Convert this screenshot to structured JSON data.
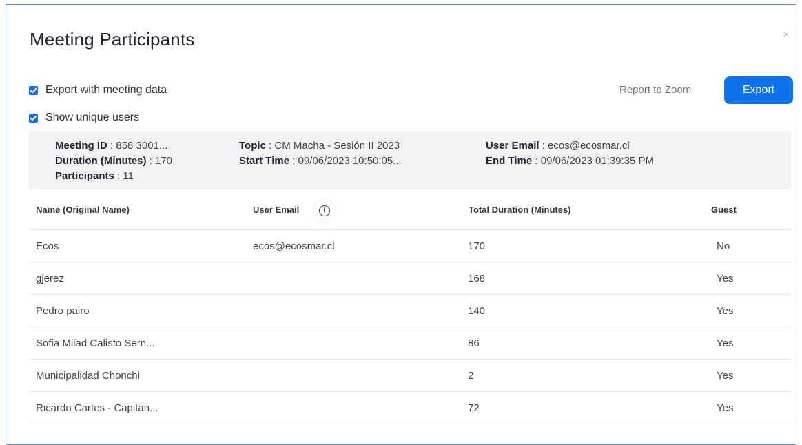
{
  "dialog": {
    "title": "Meeting Participants",
    "close_symbol": "×"
  },
  "options": {
    "export_with_meeting_data": {
      "label": "Export with meeting data",
      "checked": true
    },
    "show_unique_users": {
      "label": "Show unique users",
      "checked": true
    }
  },
  "actions": {
    "report_label": "Report to Zoom",
    "export_label": "Export"
  },
  "meeting_info": {
    "meeting_id_label": "Meeting ID",
    "meeting_id_value": " : 858 3001...",
    "duration_label": "Duration (Minutes)",
    "duration_value": " : 170",
    "participants_label": "Participants",
    "participants_value": " : 11",
    "topic_label": "Topic",
    "topic_value": " : CM Macha - Sesión II 2023",
    "start_time_label": "Start Time",
    "start_time_value": " : 09/06/2023 10:50:05...",
    "user_email_label": "User Email",
    "user_email_value": " : ecos@ecosmar.cl",
    "end_time_label": "End Time",
    "end_time_value": " : 09/06/2023 01:39:35 PM"
  },
  "table": {
    "headers": {
      "name": "Name (Original Name)",
      "email": "User Email",
      "duration": "Total Duration (Minutes)",
      "guest": "Guest"
    },
    "rows": [
      {
        "name": "Ecos",
        "email": "ecos@ecosmar.cl",
        "duration": "170",
        "guest": "No"
      },
      {
        "name": "gjerez",
        "email": "",
        "duration": "168",
        "guest": "Yes"
      },
      {
        "name": "Pedro pairo",
        "email": "",
        "duration": "140",
        "guest": "Yes"
      },
      {
        "name": "Sofia Milad Calisto Sern...",
        "email": "",
        "duration": "86",
        "guest": "Yes"
      },
      {
        "name": "Municipalidad Chonchi",
        "email": "",
        "duration": "2",
        "guest": "Yes"
      },
      {
        "name": "Ricardo Cartes - Capitan...",
        "email": "",
        "duration": "72",
        "guest": "Yes"
      }
    ]
  },
  "colors": {
    "accent": "#0e72ed",
    "checkbox": "#1a6fe0",
    "panel_bg": "#f3f3f6"
  }
}
